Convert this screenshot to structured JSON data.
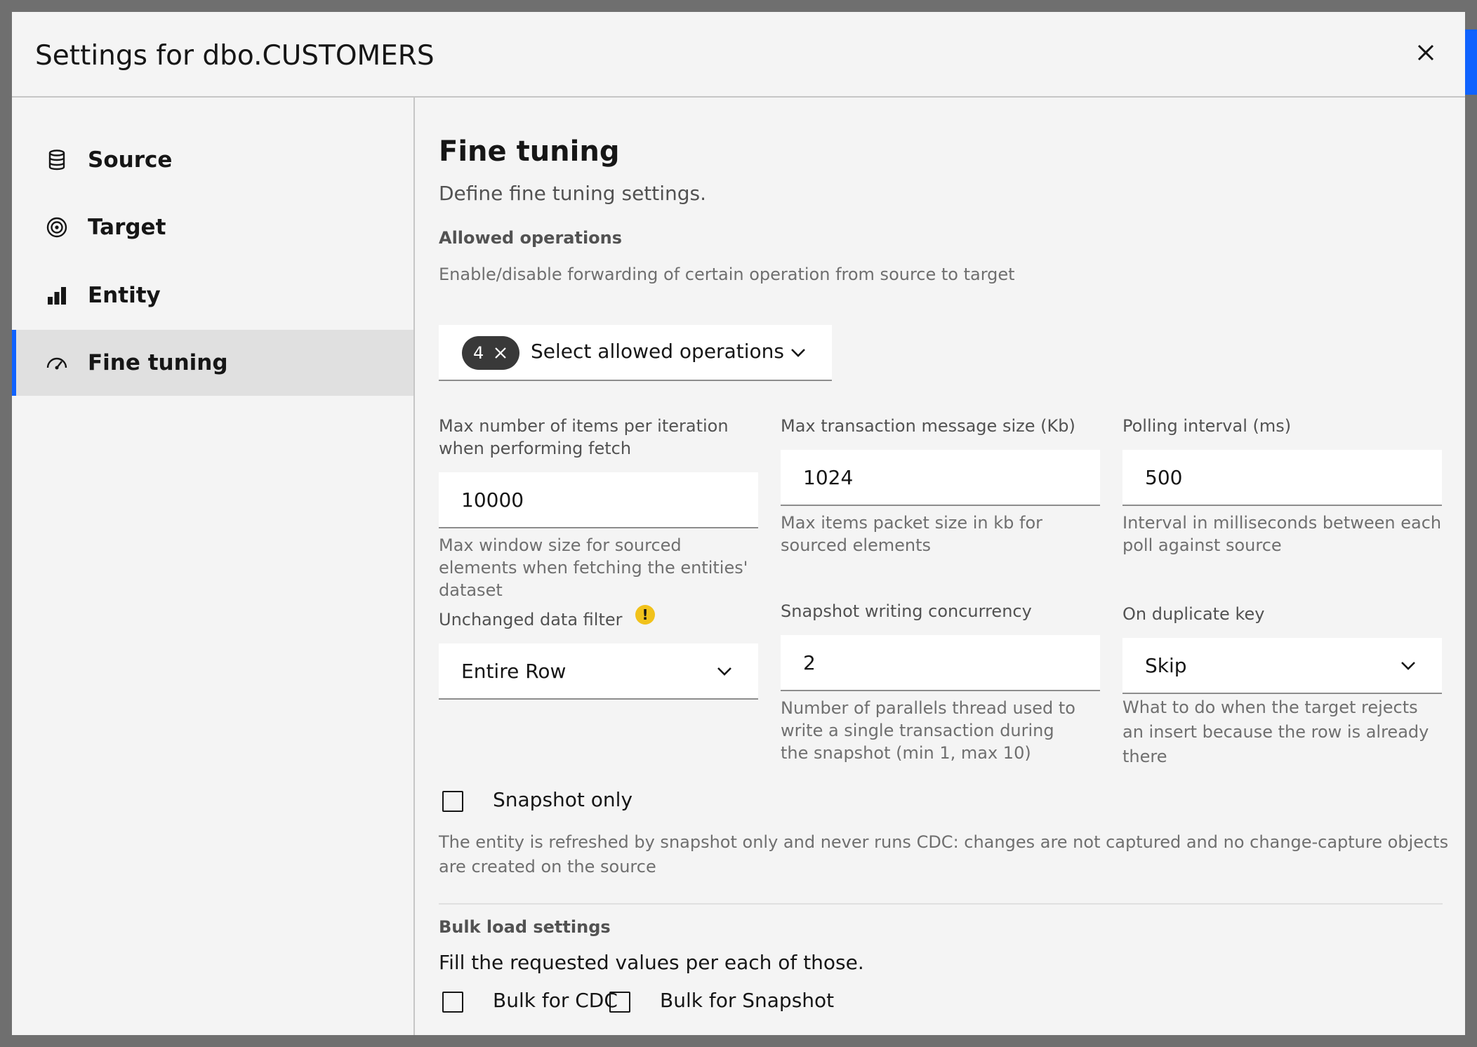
{
  "modal": {
    "title": "Settings for dbo.CUSTOMERS"
  },
  "sidebar": {
    "items": [
      {
        "label": "Source",
        "icon": "database-icon"
      },
      {
        "label": "Target",
        "icon": "target-icon"
      },
      {
        "label": "Entity",
        "icon": "bar-chart-icon"
      },
      {
        "label": "Fine tuning",
        "icon": "gauge-icon",
        "active": true
      }
    ]
  },
  "main": {
    "title": "Fine tuning",
    "subtitle": "Define fine tuning settings.",
    "allowed_operations": {
      "heading": "Allowed operations",
      "description": "Enable/disable forwarding of certain operation from source to target",
      "tag_count": "4",
      "placeholder": "Select allowed operations"
    },
    "max_items": {
      "label": "Max number of items per iteration when performing fetch",
      "value": "10000",
      "helper": "Max window size for sourced elements when fetching the entities' dataset"
    },
    "max_msg_size": {
      "label": "Max transaction message size (Kb)",
      "value": "1024",
      "helper": "Max items packet size in kb for sourced elements"
    },
    "polling_interval": {
      "label": "Polling interval (ms)",
      "value": "500",
      "helper": "Interval in milliseconds between each poll against source"
    },
    "unchanged_filter": {
      "label": "Unchanged data filter",
      "value": "Entire Row"
    },
    "snapshot_concurrency": {
      "label": "Snapshot writing concurrency",
      "value": "2",
      "helper": "Number of parallels thread used to write a single transaction during the snapshot (min 1, max 10)"
    },
    "duplicate_key": {
      "label": "On duplicate key",
      "value": "Skip",
      "helper": "What to do when the target rejects an insert because the row is already there"
    },
    "snapshot_only": {
      "label": "Snapshot only",
      "helper": "The entity is refreshed by snapshot only and never runs CDC: changes are not captured and no change-capture objects are created on the source"
    },
    "bulk": {
      "heading": "Bulk load settings",
      "description": "Fill the requested values per each of those.",
      "cdc_label": "Bulk for CDC",
      "snapshot_label": "Bulk for Snapshot"
    }
  },
  "colors": {
    "accent": "#0f62fe",
    "warning": "#f1c21b",
    "tag_bg": "#393939"
  }
}
